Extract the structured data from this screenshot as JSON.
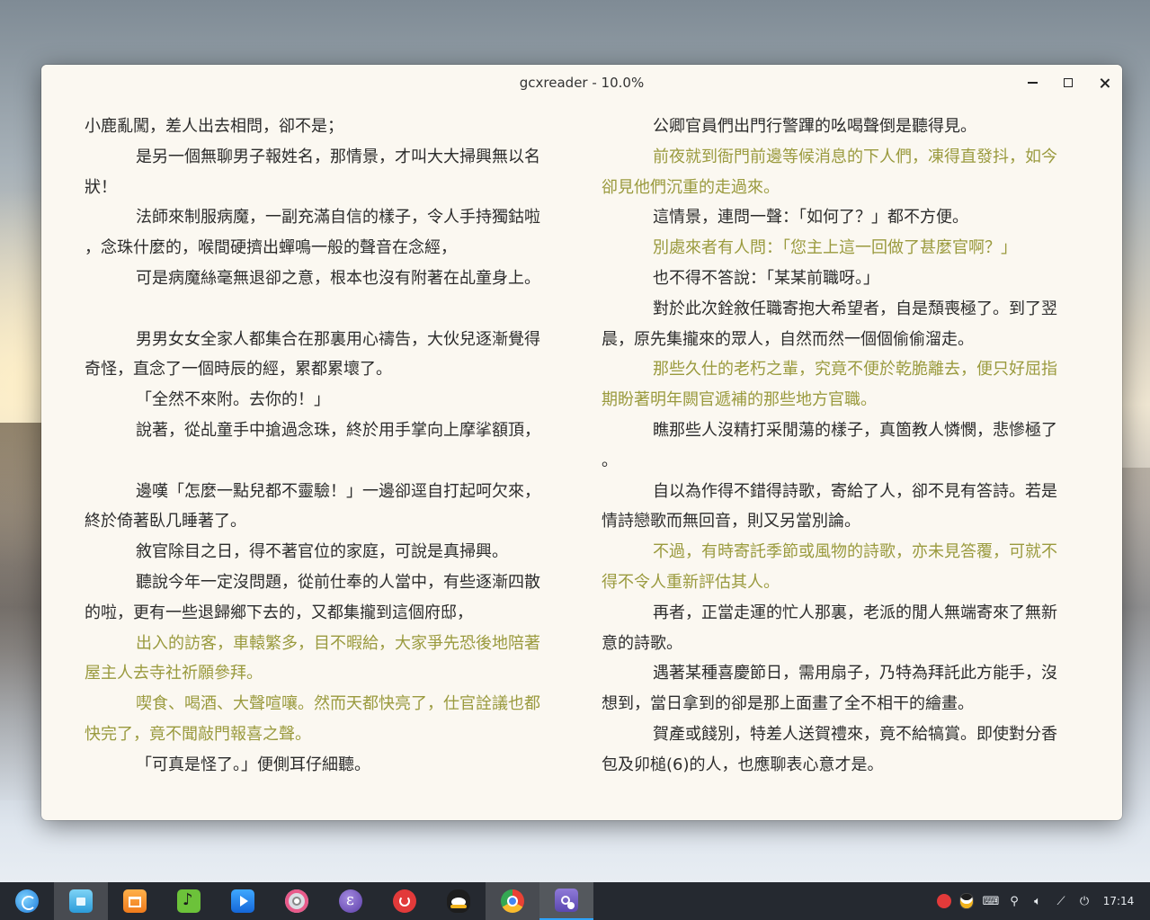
{
  "window": {
    "title": "gcxreader - 10.0%"
  },
  "left_page": {
    "lines": [
      {
        "text": "小鹿亂闖，差人出去相問，卻不是；",
        "indent": false,
        "hl": false
      },
      {
        "text": "是另一個無聊男子報姓名，那情景，才叫大大掃興無以名",
        "indent": true,
        "hl": false
      },
      {
        "text": "狀！",
        "indent": false,
        "hl": false
      },
      {
        "text": "法師來制服病魔，一副充滿自信的樣子，令人手持獨鈷啦",
        "indent": true,
        "hl": false
      },
      {
        "text": "，念珠什麼的，喉間硬擠出蟬鳴一般的聲音在念經，",
        "indent": false,
        "hl": false
      },
      {
        "text": "可是病魔絲毫無退卻之意，根本也沒有附著在乩童身上。",
        "indent": true,
        "hl": false
      },
      {
        "text": "",
        "indent": false,
        "hl": false
      },
      {
        "text": "男男女女全家人都集合在那裏用心禱告，大伙兒逐漸覺得",
        "indent": true,
        "hl": false
      },
      {
        "text": "奇怪，直念了一個時辰的經，累都累壞了。",
        "indent": false,
        "hl": false
      },
      {
        "text": "「全然不來附。去你的！」",
        "indent": true,
        "hl": false
      },
      {
        "text": "說著，從乩童手中搶過念珠，終於用手掌向上摩挲額頂，",
        "indent": true,
        "hl": false
      },
      {
        "text": "",
        "indent": false,
        "hl": false
      },
      {
        "text": "邊嘆「怎麼一點兒都不靈驗！」一邊卻逕自打起呵欠來，",
        "indent": true,
        "hl": false
      },
      {
        "text": "終於倚著臥几睡著了。",
        "indent": false,
        "hl": false
      },
      {
        "text": "敘官除目之日，得不著官位的家庭，可說是真掃興。",
        "indent": true,
        "hl": false
      },
      {
        "text": "聽說今年一定沒問題，從前仕奉的人當中，有些逐漸四散",
        "indent": true,
        "hl": false
      },
      {
        "text": "的啦，更有一些退歸鄉下去的，又都集攏到這個府邸，",
        "indent": false,
        "hl": false
      },
      {
        "text": "出入的訪客，車轅繁多，目不暇給，大家爭先恐後地陪著",
        "indent": true,
        "hl": true
      },
      {
        "text": "屋主人去寺社祈願參拜。",
        "indent": false,
        "hl": true
      },
      {
        "text": "喫食、喝酒、大聲喧嚷。然而天都快亮了，仕官詮議也都",
        "indent": true,
        "hl": true
      },
      {
        "text": "快完了，竟不聞敲門報喜之聲。",
        "indent": false,
        "hl": true
      },
      {
        "text": "「可真是怪了。」便側耳仔細聽。",
        "indent": true,
        "hl": false
      }
    ]
  },
  "right_page": {
    "lines": [
      {
        "text": "公卿官員們出門行警蹕的吆喝聲倒是聽得見。",
        "indent": true,
        "hl": false
      },
      {
        "text": "前夜就到衙門前邊等候消息的下人們，凍得直發抖，如今",
        "indent": true,
        "hl": true
      },
      {
        "text": "卻見他們沉重的走過來。",
        "indent": false,
        "hl": true
      },
      {
        "text": "這情景，連問一聲：「如何了？」都不方便。",
        "indent": true,
        "hl": false
      },
      {
        "text": "別處來者有人問：「您主上這一回做了甚麼官啊？」",
        "indent": true,
        "hl": true
      },
      {
        "text": "也不得不答說：「某某前職呀。」",
        "indent": true,
        "hl": false
      },
      {
        "text": "對於此次銓敘任職寄抱大希望者，自是頹喪極了。到了翌",
        "indent": true,
        "hl": false
      },
      {
        "text": "晨，原先集攏來的眾人，自然而然一個個偷偷溜走。",
        "indent": false,
        "hl": false
      },
      {
        "text": "那些久仕的老朽之輩，究竟不便於乾脆離去，便只好屈指",
        "indent": true,
        "hl": true
      },
      {
        "text": "期盼著明年闕官遞補的那些地方官職。",
        "indent": false,
        "hl": true
      },
      {
        "text": "瞧那些人沒精打采閒蕩的樣子，真箇教人憐憫，悲慘極了",
        "indent": true,
        "hl": false
      },
      {
        "text": "。",
        "indent": false,
        "hl": false
      },
      {
        "text": "自以為作得不錯得詩歌，寄給了人，卻不見有答詩。若是",
        "indent": true,
        "hl": false
      },
      {
        "text": "情詩戀歌而無回音，則又另當別論。",
        "indent": false,
        "hl": false
      },
      {
        "text": "不過，有時寄託季節或風物的詩歌，亦未見答覆，可就不",
        "indent": true,
        "hl": true
      },
      {
        "text": "得不令人重新評估其人。",
        "indent": false,
        "hl": true
      },
      {
        "text": "再者，正當走運的忙人那裏，老派的閒人無端寄來了無新",
        "indent": true,
        "hl": false
      },
      {
        "text": "意的詩歌。",
        "indent": false,
        "hl": false
      },
      {
        "text": "遇著某種喜慶節日，需用扇子，乃特為拜託此方能手，沒",
        "indent": true,
        "hl": false
      },
      {
        "text": "想到，當日拿到的卻是那上面畫了全不相干的繪畫。",
        "indent": false,
        "hl": false
      },
      {
        "text": "賀產或餞別，特差人送賀禮來，竟不給犒賞。即使對分香",
        "indent": true,
        "hl": false
      },
      {
        "text": "包及卯槌(6)的人，也應聊表心意才是。",
        "indent": false,
        "hl": false
      }
    ]
  },
  "colors": {
    "page_background": "#fbf8f1",
    "text": "#2c2c2c",
    "highlight_text": "#9a9a3e",
    "taskbar_active_indicator": "#2ea2f8"
  },
  "taskbar": {
    "apps": [
      {
        "name": "launcher-icon",
        "cls": "ico-launcher",
        "state": ""
      },
      {
        "name": "file-manager-icon",
        "cls": "ico-files",
        "state": "active"
      },
      {
        "name": "app-store-icon",
        "cls": "ico-store",
        "state": ""
      },
      {
        "name": "music-player-icon",
        "cls": "ico-music",
        "state": ""
      },
      {
        "name": "movie-player-icon",
        "cls": "ico-movie",
        "state": ""
      },
      {
        "name": "control-center-icon",
        "cls": "ico-settings",
        "state": ""
      },
      {
        "name": "emacs-icon",
        "cls": "ico-emacs",
        "state": ""
      },
      {
        "name": "netease-music-icon",
        "cls": "ico-netease",
        "state": ""
      },
      {
        "name": "qq-icon",
        "cls": "ico-qq",
        "state": ""
      },
      {
        "name": "chrome-icon",
        "cls": "ico-chrome",
        "state": "active"
      },
      {
        "name": "gcxreader-icon",
        "cls": "ico-reader",
        "state": "focused"
      }
    ],
    "tray": [
      "netease-tray-icon",
      "qq-tray-icon",
      "keyboard-icon",
      "usb-icon",
      "volume-icon",
      "network-icon",
      "power-icon"
    ],
    "clock": "17:14"
  }
}
